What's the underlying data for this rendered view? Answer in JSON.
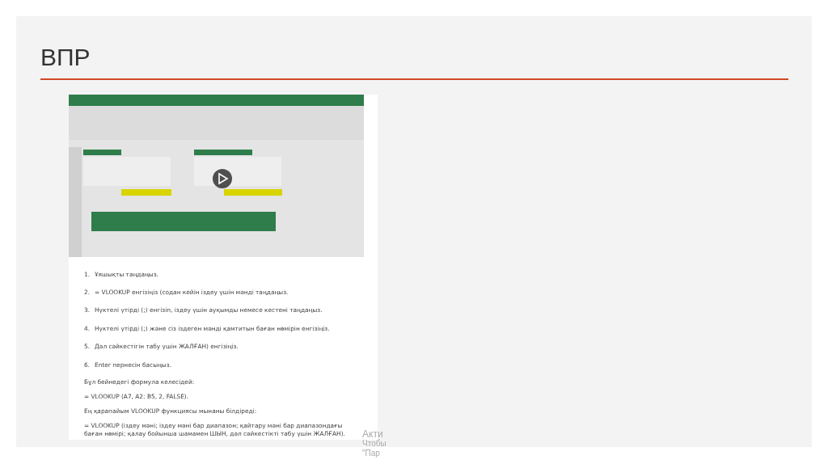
{
  "slide": {
    "title": "ВПР",
    "steps": [
      {
        "number": "1.",
        "text": "Ұяшықты таңдаңыз."
      },
      {
        "number": "2.",
        "text": "= VLOOKUP енгізіңіз (содан кейін іздеу үшін мәнді таңдаңыз."
      },
      {
        "number": "3.",
        "text": "Нүктелі үтірді (;) енгізіп, іздеу үшін ауқымды немесе кестені таңдаңыз."
      },
      {
        "number": "4.",
        "text": "Нүктелі үтірді (;) және сіз іздеген мәнді қамтитын баған нөмірін енгізіңіз."
      },
      {
        "number": "5.",
        "text": "Дәл сәйкестігін табу үшін ЖАЛҒАН) енгізіңіз."
      },
      {
        "number": "6.",
        "text": "Enter пернесін басыңыз."
      }
    ],
    "paragraphs": [
      "Бұл бейнедегі формула келесідей:",
      "= VLOOKUP (A7, A2: B5, 2, FALSE).",
      "Ең қарапайым VLOOKUP функциясы мынаны білдіреді:",
      "= VLOOKUP (іздеу мәні; іздеу мәні бар диапазон; қайтару мәні бар диапазондағы баған нөмірі; қалау бойынша шамамен ШЫН, дәл сәйкестікті табу үшін ЖАЛҒАН)."
    ]
  },
  "activation_notice": [
    "Акти",
    "Чтобы",
    "\"Пар"
  ]
}
